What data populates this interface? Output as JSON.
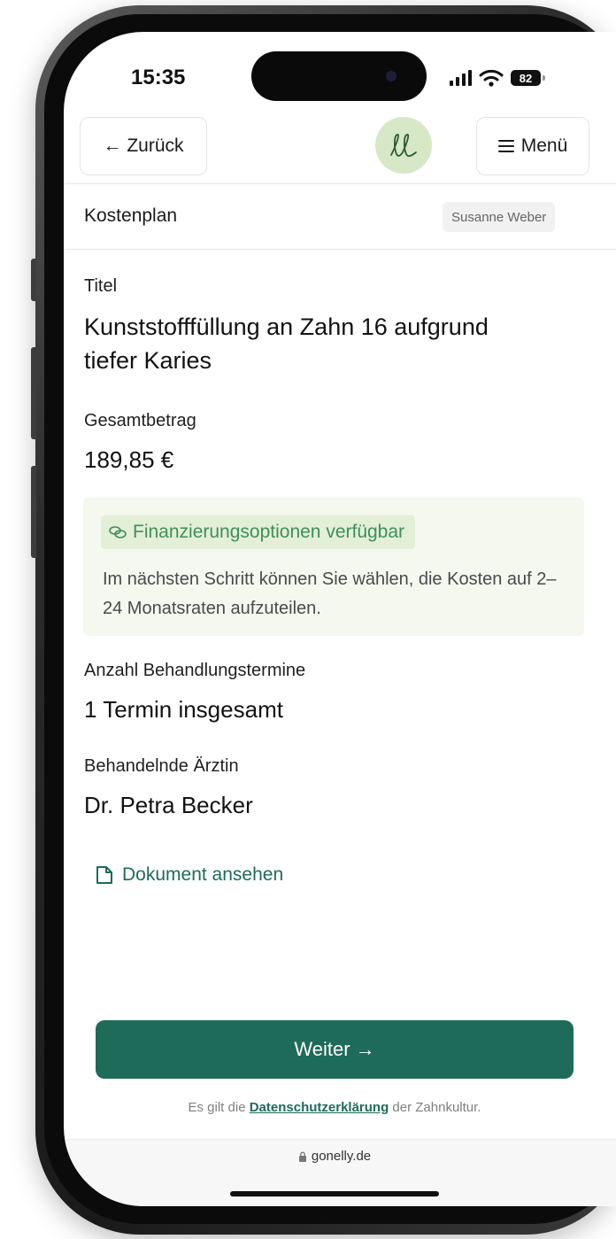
{
  "status_bar": {
    "time": "15:35",
    "battery": "82"
  },
  "nav": {
    "back_label": "← Zurück",
    "menu_label": "Menü",
    "logo_glyph": "ℓℓ"
  },
  "subheader": {
    "page_title": "Kostenplan",
    "user_name": "Susanne Weber"
  },
  "plan": {
    "title_label": "Titel",
    "title_value": "Kunststofffüllung an Zahn 16 aufgrund tiefer Karies",
    "total_label": "Gesamtbetrag",
    "total_value": "189,85 €",
    "financing_badge": "Finanzierungsoptionen verfügbar",
    "financing_text": "Im nächsten Schritt können Sie wählen, die Kosten auf 2–24 Monatsraten aufzuteilen.",
    "appointments_label": "Anzahl Behandlungstermine",
    "appointments_value": "1 Termin insgesamt",
    "doctor_label": "Behandelnde Ärztin",
    "doctor_value": "Dr. Petra Becker",
    "document_link": "Dokument ansehen"
  },
  "footer": {
    "continue_label": "Weiter →",
    "privacy_prefix": "Es gilt die ",
    "privacy_link": "Datenschutzerklärung",
    "privacy_suffix": " der Zahnkultur.",
    "url": "gonelly.de"
  },
  "colors": {
    "brand_green": "#1e6b59",
    "finance_bg": "#f4f8ef",
    "finance_chip": "#e3efd6",
    "logo_bg": "#d6e8c6"
  },
  "icons": [
    "arrow-left-icon",
    "logo-icon",
    "menu-icon",
    "money-icon",
    "document-icon",
    "lock-icon",
    "signal-icon",
    "wifi-icon",
    "battery-icon"
  ]
}
